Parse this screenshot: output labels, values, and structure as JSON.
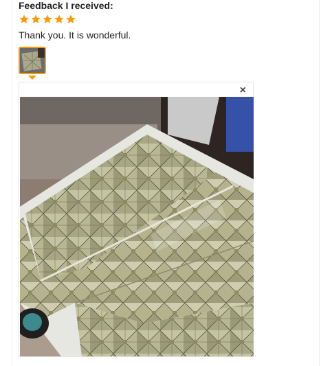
{
  "feedback": {
    "title": "Feedback I received:",
    "rating": 5,
    "rating_max": 5,
    "star_color": "#ff9900",
    "comment": "Thank you. It is wonderful.",
    "close_icon_glyph": "×",
    "images": [
      {
        "name": "mosaic-tile-photo"
      }
    ]
  }
}
